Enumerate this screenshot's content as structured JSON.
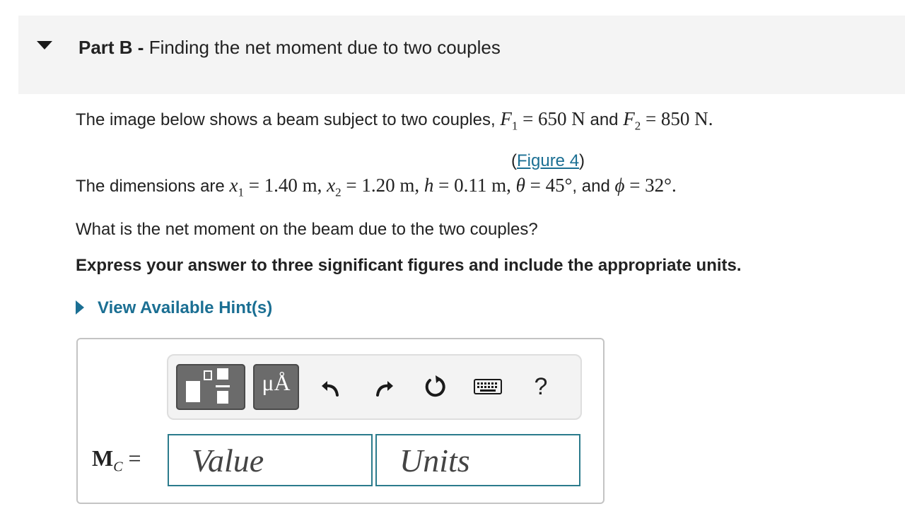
{
  "part": {
    "label": "Part B",
    "separator": " - ",
    "title": "Finding the net moment due to two couples"
  },
  "problem": {
    "intro_text": "The image below shows a beam subject to two couples, ",
    "and_text": " and ",
    "period": ".",
    "forces": {
      "F1_symbol": "F",
      "F1_sub": "1",
      "F1_value": " = 650 N",
      "F2_symbol": "F",
      "F2_sub": "2",
      "F2_value": " = 850 N"
    },
    "figure_link": {
      "open": "(",
      "label": "Figure 4",
      "close": ")"
    },
    "dims_intro": "The dimensions are ",
    "dims": {
      "x1_symbol": "x",
      "x1_sub": "1",
      "x1_value": " = 1.40 m, ",
      "x2_symbol": "x",
      "x2_sub": "2",
      "x2_value": " = 1.20 m, ",
      "h_symbol": "h",
      "h_value": " = 0.11 m, ",
      "theta_symbol": "θ",
      "theta_value": " = 45°",
      "and_text": ", and ",
      "phi_symbol": "ϕ",
      "phi_value": " = 32°",
      "period": "."
    },
    "question": "What is the net moment on the beam due to the two couples?",
    "instruction": "Express your answer to three significant figures and include the appropriate units."
  },
  "hints": {
    "label": "View Available Hint(s)"
  },
  "toolbar": {
    "units_label": "μÅ",
    "help_label": "?",
    "icons": [
      "templates-icon",
      "units-icon",
      "undo-icon",
      "redo-icon",
      "reset-icon",
      "keyboard-icon",
      "help-icon"
    ]
  },
  "answer": {
    "label_main": "M",
    "label_sub": "C",
    "label_eq": " =",
    "value_placeholder": "Value",
    "units_placeholder": "Units",
    "value": "",
    "units": ""
  },
  "colors": {
    "link": "#1b6f93",
    "input_border": "#2b7b8c",
    "header_bg": "#f4f4f4",
    "toolbar_button": "#6b6b6b"
  }
}
